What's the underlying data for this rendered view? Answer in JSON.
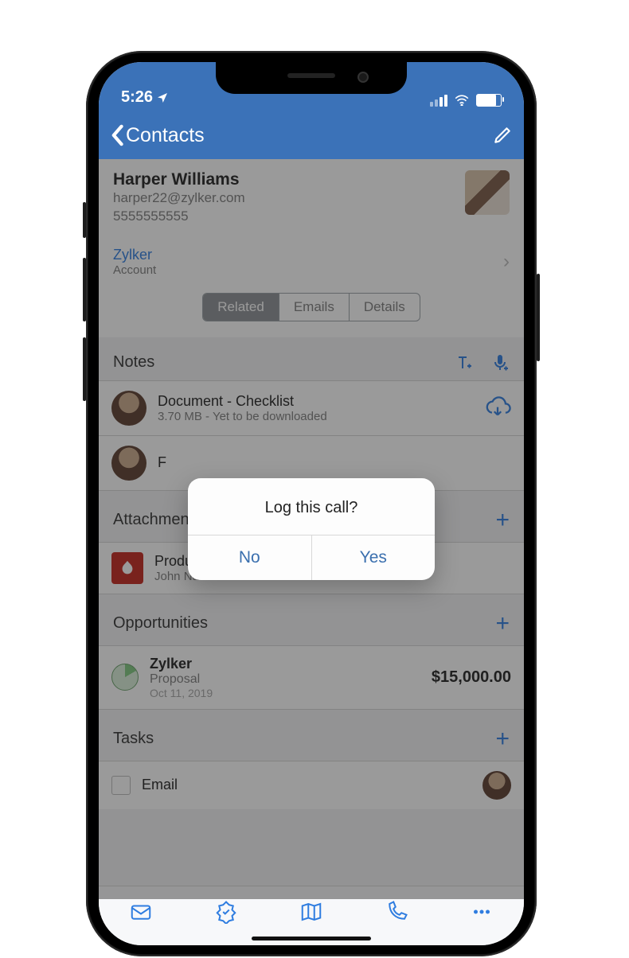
{
  "statusbar": {
    "time": "5:26"
  },
  "navbar": {
    "back_label": "Contacts"
  },
  "contact": {
    "name": "Harper Williams",
    "email": "harper22@zylker.com",
    "phone": "5555555555",
    "account_name": "Zylker",
    "account_label": "Account"
  },
  "tabs": {
    "related": "Related",
    "emails": "Emails",
    "details": "Details"
  },
  "sections": {
    "notes_title": "Notes",
    "attachments_title": "Attachments",
    "opportunities_title": "Opportunities",
    "tasks_title": "Tasks"
  },
  "notes": [
    {
      "title": "Document - Checklist",
      "size": "3.70 MB",
      "status": "Yet to be downloaded"
    },
    {
      "title": "F"
    }
  ],
  "attachments": [
    {
      "title": "Product specification.pdf",
      "owner": "John Nash"
    }
  ],
  "opportunities": [
    {
      "title": "Zylker",
      "stage": "Proposal",
      "date": "Oct 11, 2019",
      "amount": "$15,000.00"
    }
  ],
  "tasks": [
    {
      "title": "Email"
    }
  ],
  "dialog": {
    "title": "Log this call?",
    "no": "No",
    "yes": "Yes"
  }
}
